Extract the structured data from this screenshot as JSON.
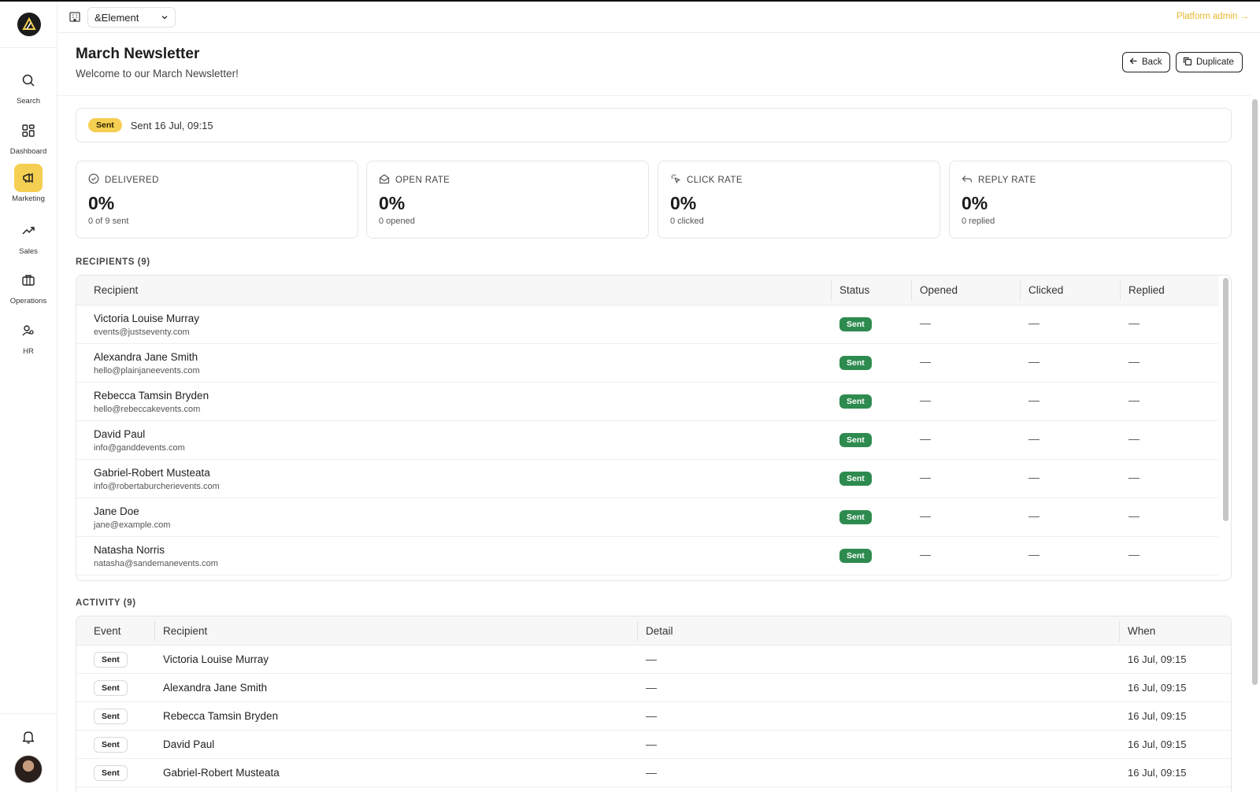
{
  "app": {
    "org_name": "&Element",
    "platform_admin": "Platform admin →"
  },
  "sidebar": {
    "items": [
      {
        "label": "Search",
        "icon": "search-icon"
      },
      {
        "label": "Dashboard",
        "icon": "grid-icon"
      },
      {
        "label": "Marketing",
        "icon": "megaphone-icon",
        "active": true
      },
      {
        "label": "Sales",
        "icon": "trending-up-icon"
      },
      {
        "label": "Operations",
        "icon": "briefcase-icon"
      },
      {
        "label": "HR",
        "icon": "people-icon"
      }
    ]
  },
  "header": {
    "title": "March Newsletter",
    "subtitle": "Welcome to our March Newsletter!",
    "back_label": "Back",
    "duplicate_label": "Duplicate"
  },
  "status_banner": {
    "badge": "Sent",
    "text": "Sent 16 Jul, 09:15"
  },
  "stats": [
    {
      "label": "DELIVERED",
      "value": "0%",
      "sub": "0 of 9 sent",
      "icon": "check-circle-icon"
    },
    {
      "label": "OPEN RATE",
      "value": "0%",
      "sub": "0 opened",
      "icon": "open-envelope-icon"
    },
    {
      "label": "CLICK RATE",
      "value": "0%",
      "sub": "0 clicked",
      "icon": "pointer-click-icon"
    },
    {
      "label": "REPLY RATE",
      "value": "0%",
      "sub": "0 replied",
      "icon": "reply-icon"
    }
  ],
  "recipients": {
    "title": "RECIPIENTS (9)",
    "columns": [
      "Recipient",
      "Status",
      "Opened",
      "Clicked",
      "Replied"
    ],
    "rows": [
      {
        "name": "Victoria Louise Murray",
        "email": "events@justseventy.com",
        "status": "Sent",
        "opened": "—",
        "clicked": "—",
        "replied": "—"
      },
      {
        "name": "Alexandra Jane Smith",
        "email": "hello@plainjaneevents.com",
        "status": "Sent",
        "opened": "—",
        "clicked": "—",
        "replied": "—"
      },
      {
        "name": "Rebecca Tamsin Bryden",
        "email": "hello@rebeccakevents.com",
        "status": "Sent",
        "opened": "—",
        "clicked": "—",
        "replied": "—"
      },
      {
        "name": "David Paul",
        "email": "info@ganddevents.com",
        "status": "Sent",
        "opened": "—",
        "clicked": "—",
        "replied": "—"
      },
      {
        "name": "Gabriel-Robert Musteata",
        "email": "info@robertaburcherievents.com",
        "status": "Sent",
        "opened": "—",
        "clicked": "—",
        "replied": "—"
      },
      {
        "name": "Jane Doe",
        "email": "jane@example.com",
        "status": "Sent",
        "opened": "—",
        "clicked": "—",
        "replied": "—"
      },
      {
        "name": "Natasha Norris",
        "email": "natasha@sandemanevents.com",
        "status": "Sent",
        "opened": "—",
        "clicked": "—",
        "replied": "—"
      }
    ]
  },
  "activity": {
    "title": "ACTIVITY (9)",
    "columns": [
      "Event",
      "Recipient",
      "Detail",
      "When"
    ],
    "rows": [
      {
        "event": "Sent",
        "recipient": "Victoria Louise Murray",
        "detail": "—",
        "when": "16 Jul, 09:15"
      },
      {
        "event": "Sent",
        "recipient": "Alexandra Jane Smith",
        "detail": "—",
        "when": "16 Jul, 09:15"
      },
      {
        "event": "Sent",
        "recipient": "Rebecca Tamsin Bryden",
        "detail": "—",
        "when": "16 Jul, 09:15"
      },
      {
        "event": "Sent",
        "recipient": "David Paul",
        "detail": "—",
        "when": "16 Jul, 09:15"
      },
      {
        "event": "Sent",
        "recipient": "Gabriel-Robert Musteata",
        "detail": "—",
        "when": "16 Jul, 09:15"
      }
    ]
  },
  "colors": {
    "accent": "#f5cf52",
    "status_sent_green": "#2e8b4f",
    "platform_admin": "#e9b82b"
  }
}
